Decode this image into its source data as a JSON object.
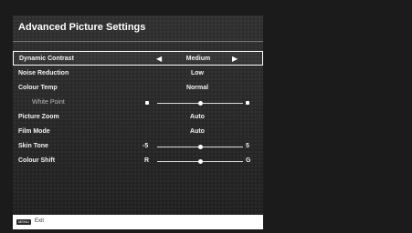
{
  "title": "Advanced Picture Settings",
  "rows": [
    {
      "label": "Dynamic Contrast",
      "value": "Medium",
      "left_arrow": "◀",
      "right_arrow": "▶"
    },
    {
      "label": "Noise Reduction",
      "value": "Low"
    },
    {
      "label": "Colour Temp",
      "value": "Normal"
    },
    {
      "label": "White Point",
      "slider_level": 0.5
    },
    {
      "label": "Picture Zoom",
      "value": "Auto"
    },
    {
      "label": "Film Mode",
      "value": "Auto"
    },
    {
      "label": "Skin Tone",
      "min_label": "-5",
      "max_label": "5",
      "slider_level": 0.5
    },
    {
      "label": "Colour Shift",
      "min_label": "R",
      "max_label": "G",
      "slider_level": 0.5
    }
  ],
  "footer": {
    "key_label": "MENU",
    "action_label": "Exit"
  },
  "colors": {
    "panel": "#2b2b2b",
    "highlight_border": "#ffffff",
    "text": "#f2f2f2",
    "subtext": "#b8b8b8"
  }
}
